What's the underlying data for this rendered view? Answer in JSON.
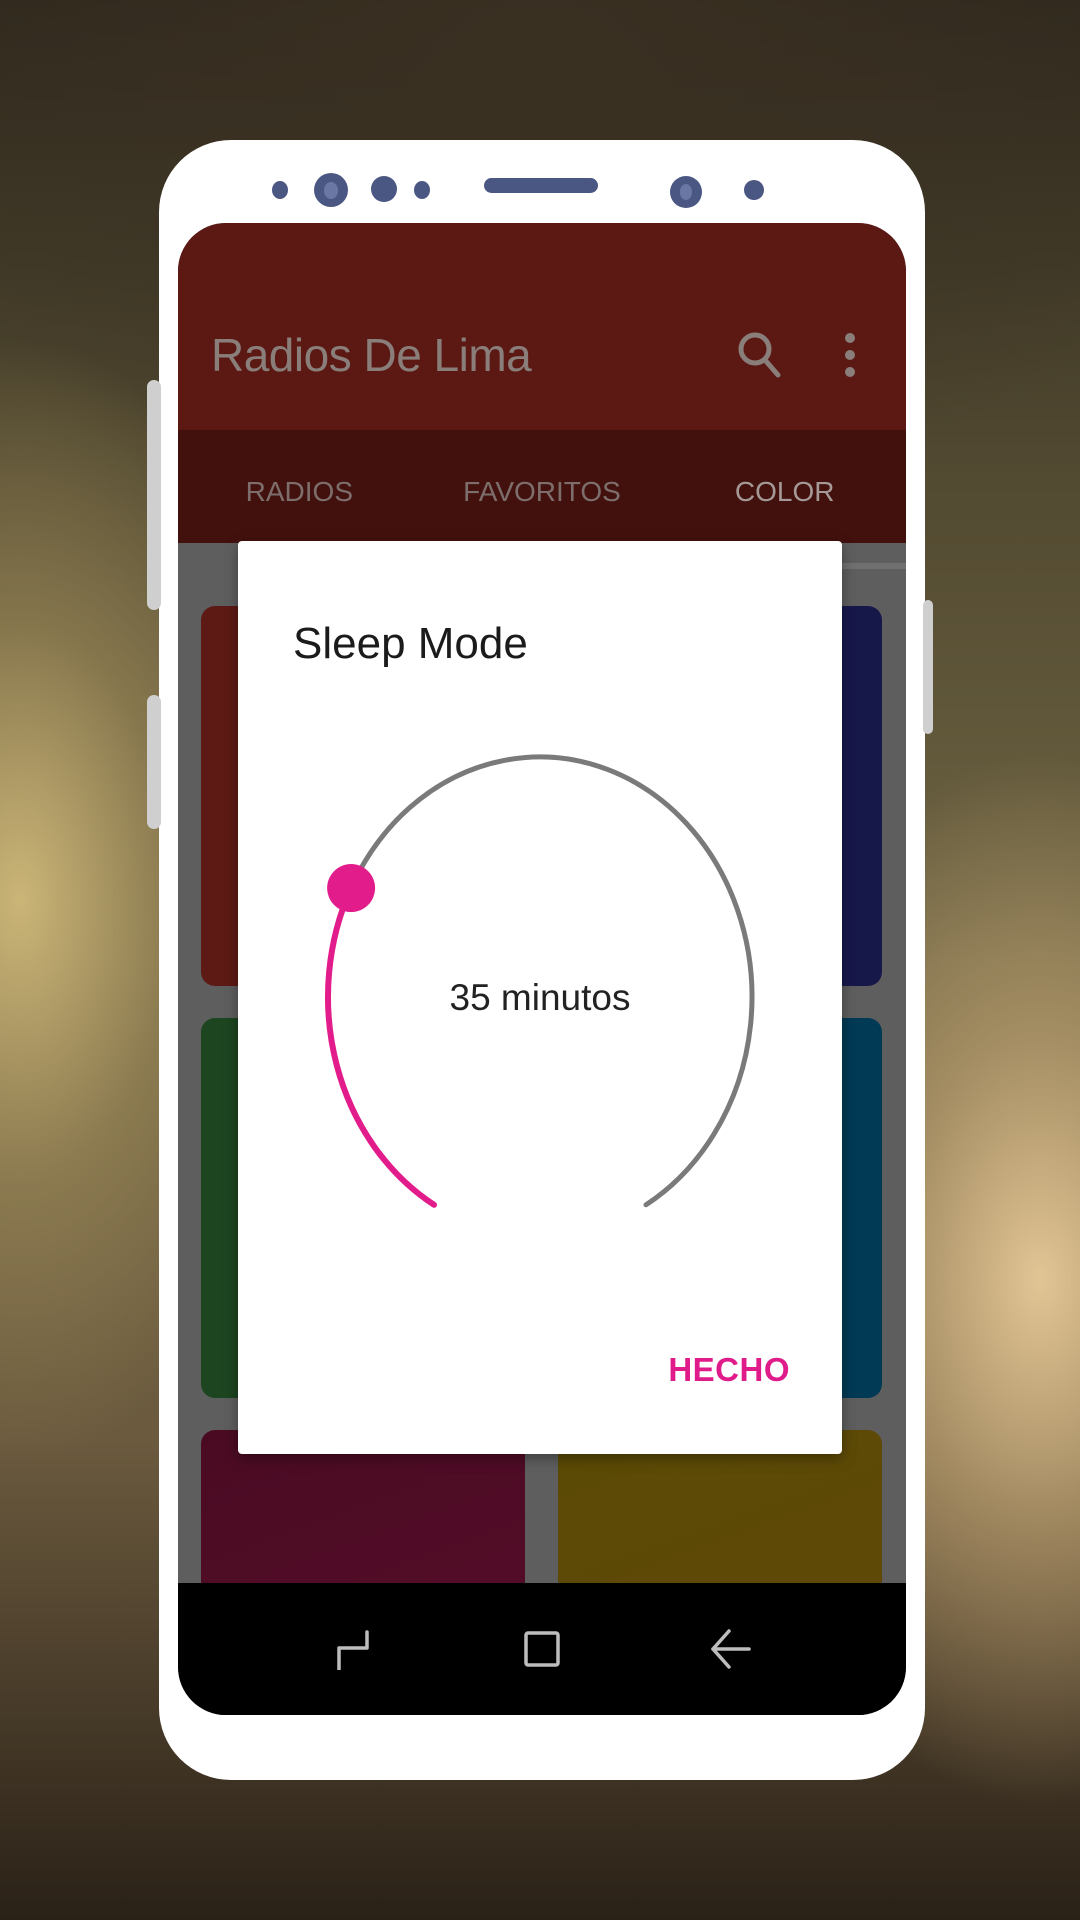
{
  "app": {
    "title": "Radios De Lima",
    "actions": [
      {
        "name": "search",
        "icon": "search-icon"
      },
      {
        "name": "more",
        "icon": "more-vert-icon"
      }
    ]
  },
  "tabs": [
    {
      "label": "RADIOS",
      "active": false
    },
    {
      "label": "FAVORITOS",
      "active": false
    },
    {
      "label": "COLOR",
      "active": true
    }
  ],
  "color_tiles": [
    {
      "name": "red",
      "color": "#5d1a15"
    },
    {
      "name": "indigo",
      "color": "#17184a"
    },
    {
      "name": "green",
      "color": "#1c4520"
    },
    {
      "name": "cyan",
      "color": "#013a55"
    },
    {
      "name": "magenta",
      "color": "#580d2a"
    },
    {
      "name": "amber",
      "color": "#604a05"
    }
  ],
  "dialog": {
    "title": "Sleep Mode",
    "timer": {
      "value_minutes": 35,
      "max_minutes": 120,
      "label": "35 minutos",
      "progress_fraction": 0.29
    },
    "done_label": "HECHO"
  },
  "colors": {
    "accent": "#e31c8b",
    "track": "#7a7a7a",
    "appbar": "#5c1914",
    "tabbar": "#42110e"
  },
  "navbar": [
    {
      "name": "recent-apps",
      "icon": "recent-apps-icon"
    },
    {
      "name": "home",
      "icon": "home-icon"
    },
    {
      "name": "back",
      "icon": "back-arrow-icon"
    }
  ]
}
